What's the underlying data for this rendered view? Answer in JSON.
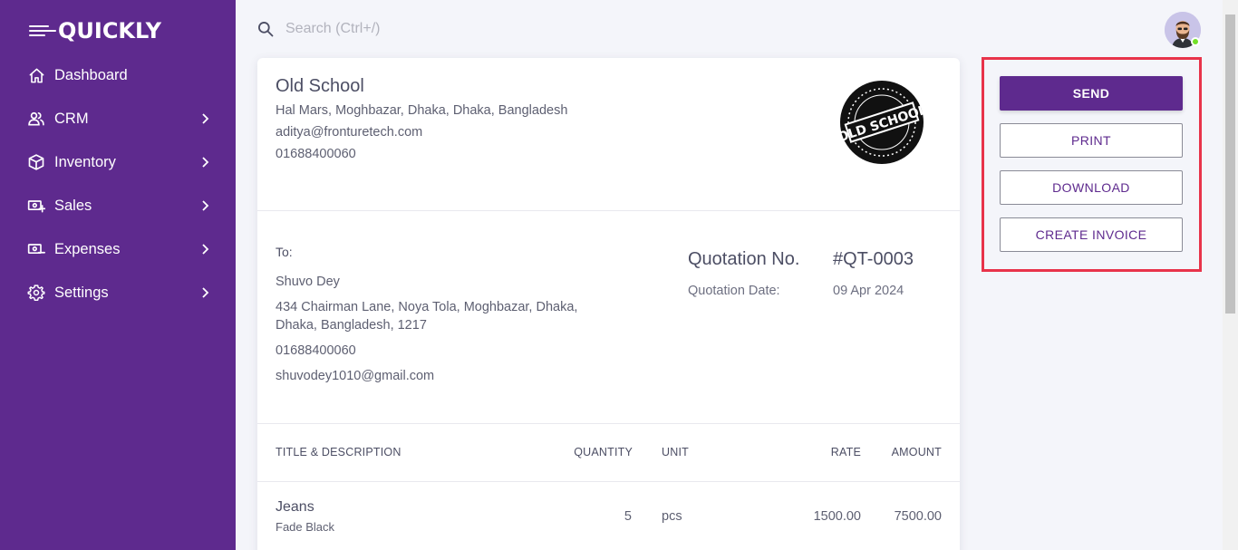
{
  "brand": {
    "logo_text": "QUICKLY"
  },
  "sidebar": {
    "items": [
      {
        "label": "Dashboard",
        "icon": "home-icon",
        "has_children": false
      },
      {
        "label": "CRM",
        "icon": "users-icon",
        "has_children": true
      },
      {
        "label": "Inventory",
        "icon": "box-icon",
        "has_children": true
      },
      {
        "label": "Sales",
        "icon": "cash-plus-icon",
        "has_children": true
      },
      {
        "label": "Expenses",
        "icon": "cash-minus-icon",
        "has_children": true
      },
      {
        "label": "Settings",
        "icon": "gear-icon",
        "has_children": true
      }
    ]
  },
  "search": {
    "placeholder": "Search (Ctrl+/)"
  },
  "company": {
    "name": "Old School",
    "address": "Hal Mars, Moghbazar, Dhaka, Dhaka, Bangladesh",
    "email": "aditya@fronturetech.com",
    "phone": "01688400060",
    "logo_text": "OLD SCHOOL"
  },
  "client": {
    "to_label": "To:",
    "name": "Shuvo Dey",
    "address": "434 Chairman Lane, Noya Tola, Moghbazar, Dhaka, Dhaka, Bangladesh, 1217",
    "phone": "01688400060",
    "email": "shuvodey1010@gmail.com"
  },
  "quotation": {
    "no_label": "Quotation No.",
    "no_value": "#QT-0003",
    "date_label": "Quotation Date:",
    "date_value": "09 Apr 2024"
  },
  "table": {
    "headers": {
      "title": "TITLE & DESCRIPTION",
      "quantity": "QUANTITY",
      "unit": "UNIT",
      "rate": "RATE",
      "amount": "AMOUNT"
    },
    "rows": [
      {
        "title": "Jeans",
        "description": "Fade Black",
        "quantity": "5",
        "unit": "pcs",
        "rate": "1500.00",
        "amount": "7500.00"
      }
    ]
  },
  "actions": {
    "send": "SEND",
    "print": "PRINT",
    "download": "DOWNLOAD",
    "create_invoice": "CREATE INVOICE"
  },
  "colors": {
    "primary": "#5e2a8e",
    "highlight_border": "#e8334a",
    "online": "#72e128"
  }
}
